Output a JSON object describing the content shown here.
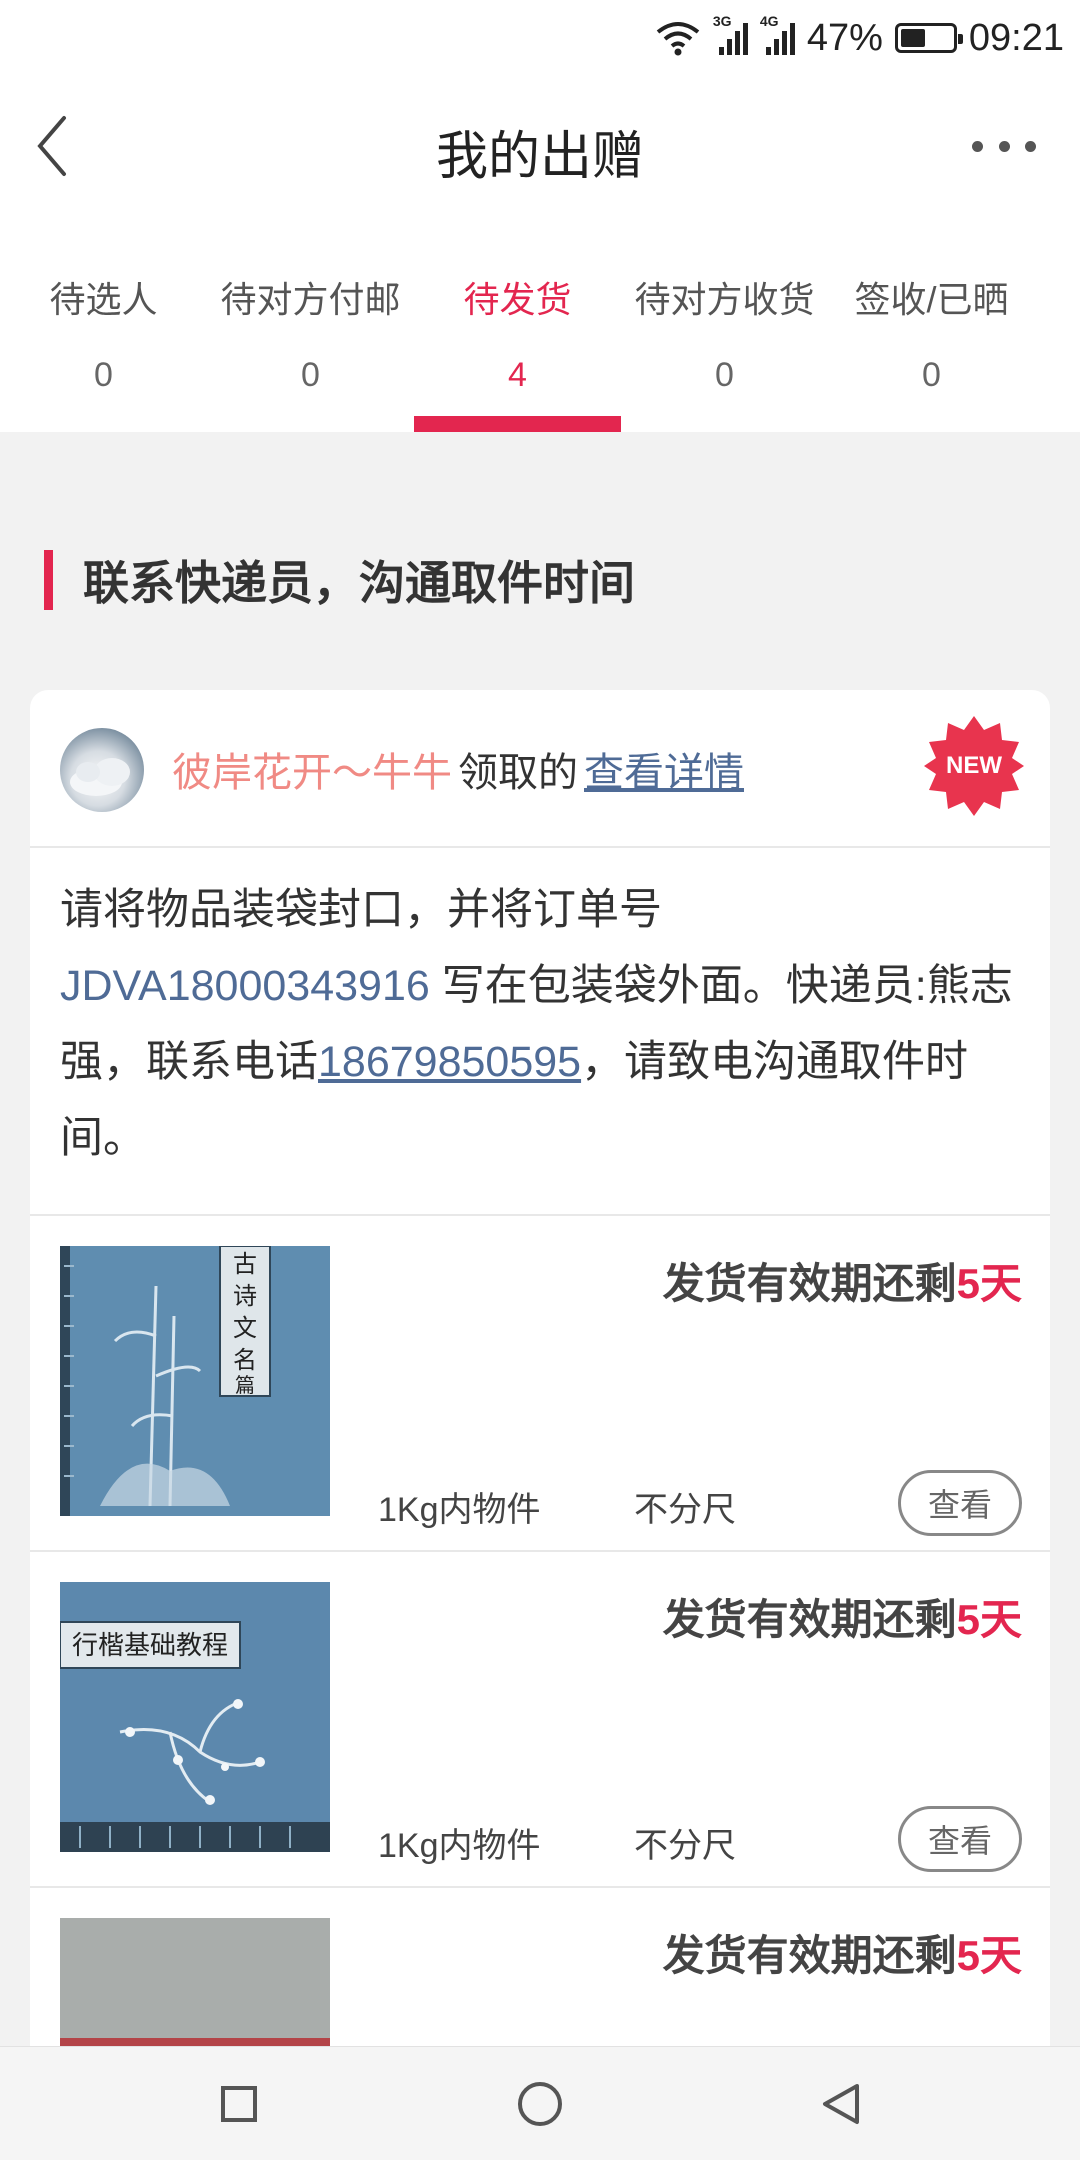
{
  "status_bar": {
    "battery": "47%",
    "battery_level": 0.47,
    "time": "09:21",
    "net1": "3G",
    "net2": "4G"
  },
  "nav": {
    "title": "我的出赠",
    "back_icon": "chevron-left-icon",
    "more_icon": "more-horizontal-icon"
  },
  "tabs": [
    {
      "label": "待选人",
      "count": "0"
    },
    {
      "label": "待对方付邮",
      "count": "0"
    },
    {
      "label": "待发货",
      "count": "4",
      "active": true
    },
    {
      "label": "待对方收货",
      "count": "0"
    },
    {
      "label": "签收/已晒",
      "count": "0"
    }
  ],
  "section_title": "联系快递员，沟通取件时间",
  "card": {
    "claimer": "彼岸花开～牛牛",
    "claimed_text": "领取的",
    "detail_link": "查看详情",
    "badge": "NEW",
    "notice_before_order": "请将物品装袋封口，并将订单号 ",
    "order_no": "JDVA18000343916",
    "notice_after_order": " 写在包装袋外面。快递员:熊志强，联系电话",
    "phone": "18679850595",
    "notice_end": "，请致电沟通取件时间。"
  },
  "items": [
    {
      "deadline_prefix": "发货有效期还剩",
      "days": "5天",
      "weight": "1Kg内物件",
      "size": "不分尺",
      "view_label": "查看",
      "cover_text": "古诗文名篇"
    },
    {
      "deadline_prefix": "发货有效期还剩",
      "days": "5天",
      "weight": "1Kg内物件",
      "size": "不分尺",
      "view_label": "查看",
      "cover_text": "行楷基础教程"
    },
    {
      "deadline_prefix": "发货有效期还剩",
      "days": "5天"
    }
  ],
  "colors": {
    "accent": "#e3264f",
    "link": "#4f6b96",
    "claimer": "#f08a84"
  },
  "system_nav": [
    "recent-apps-icon",
    "home-icon",
    "back-triangle-icon"
  ]
}
